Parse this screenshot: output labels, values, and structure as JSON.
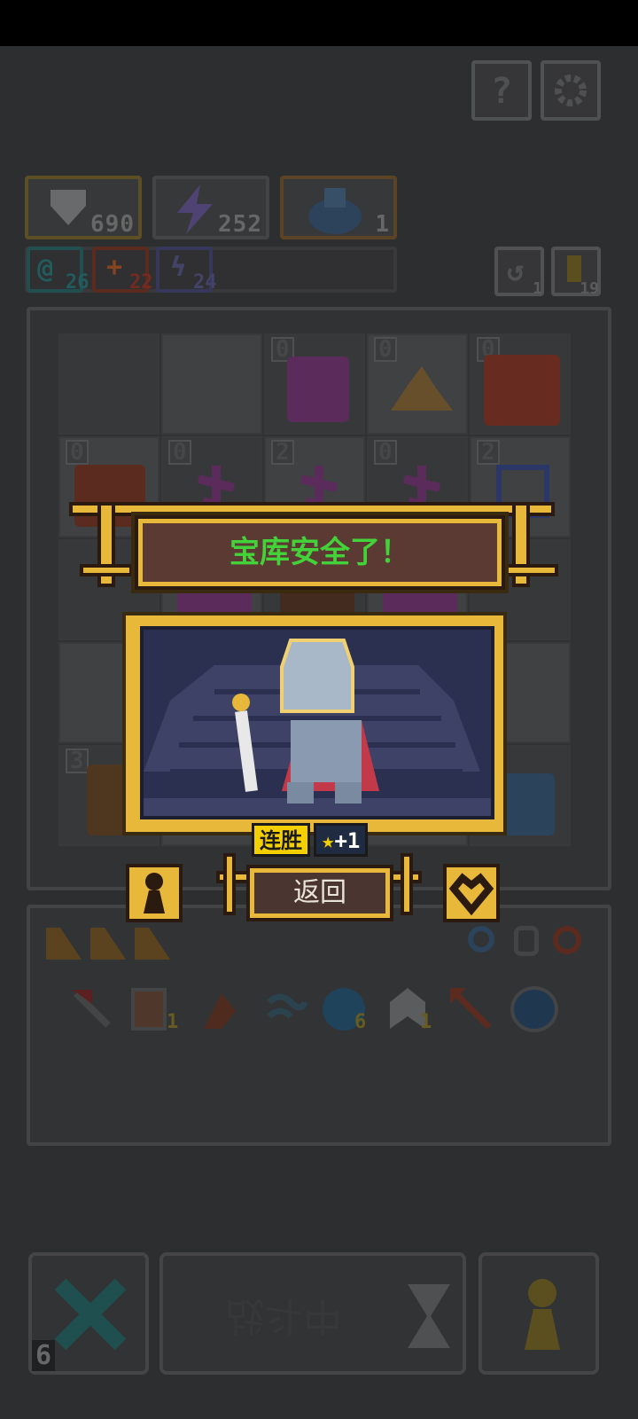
{
  "resources": {
    "shield_count": "690",
    "energy_count": "252",
    "monster_count": "1"
  },
  "sub_resources": {
    "teal_count": "26",
    "red_count": "22",
    "purple_count": "24"
  },
  "side_counters": {
    "undo_count": "1",
    "key_count": "19"
  },
  "board": {
    "cell_numbers": [
      "0",
      "0",
      "0",
      "0",
      "0",
      "2",
      "0",
      "2",
      "3"
    ]
  },
  "inventory": {
    "lantern_count": "1",
    "orb_count": "6",
    "helmet_count": "1"
  },
  "popup": {
    "title": "宝库安全了！",
    "streak_label": "连胜",
    "streak_bonus": "+1",
    "return_label": "返回"
  },
  "bottom": {
    "battle_label": "战斗中",
    "moves_left": "6"
  },
  "colors": {
    "accent_gold": "#e8b83a",
    "title_green": "#44d23a",
    "banner_bg": "#5a3a32"
  },
  "icons": [
    "help-icon",
    "settings-icon",
    "shield-icon",
    "lightning-icon",
    "monster-icon",
    "undo-icon",
    "key-icon",
    "crossed-swords-icon",
    "hourglass-icon",
    "pawn-icon",
    "heart-icon"
  ]
}
